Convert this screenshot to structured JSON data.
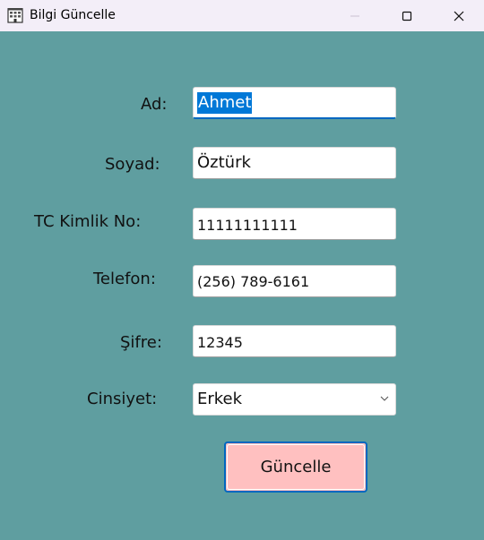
{
  "window": {
    "title": "Bilgi Güncelle",
    "icon": "building-icon"
  },
  "form": {
    "ad_label": "Ad:",
    "ad_value": "Ahmet",
    "soyad_label": "Soyad:",
    "soyad_value": "Öztürk",
    "tc_label": "TC Kimlik No:",
    "tc_value": "11111111111",
    "telefon_label": "Telefon:",
    "telefon_value": "(256) 789-6161",
    "sifre_label": "Şifre:",
    "sifre_value": "12345",
    "cinsiyet_label": "Cinsiyet:",
    "cinsiyet_value": "Erkek",
    "submit_label": "Güncelle"
  },
  "colors": {
    "background": "#5f9ea0",
    "button_bg": "#ffc0c0",
    "selection": "#0078d7",
    "focus": "#0067c0"
  }
}
